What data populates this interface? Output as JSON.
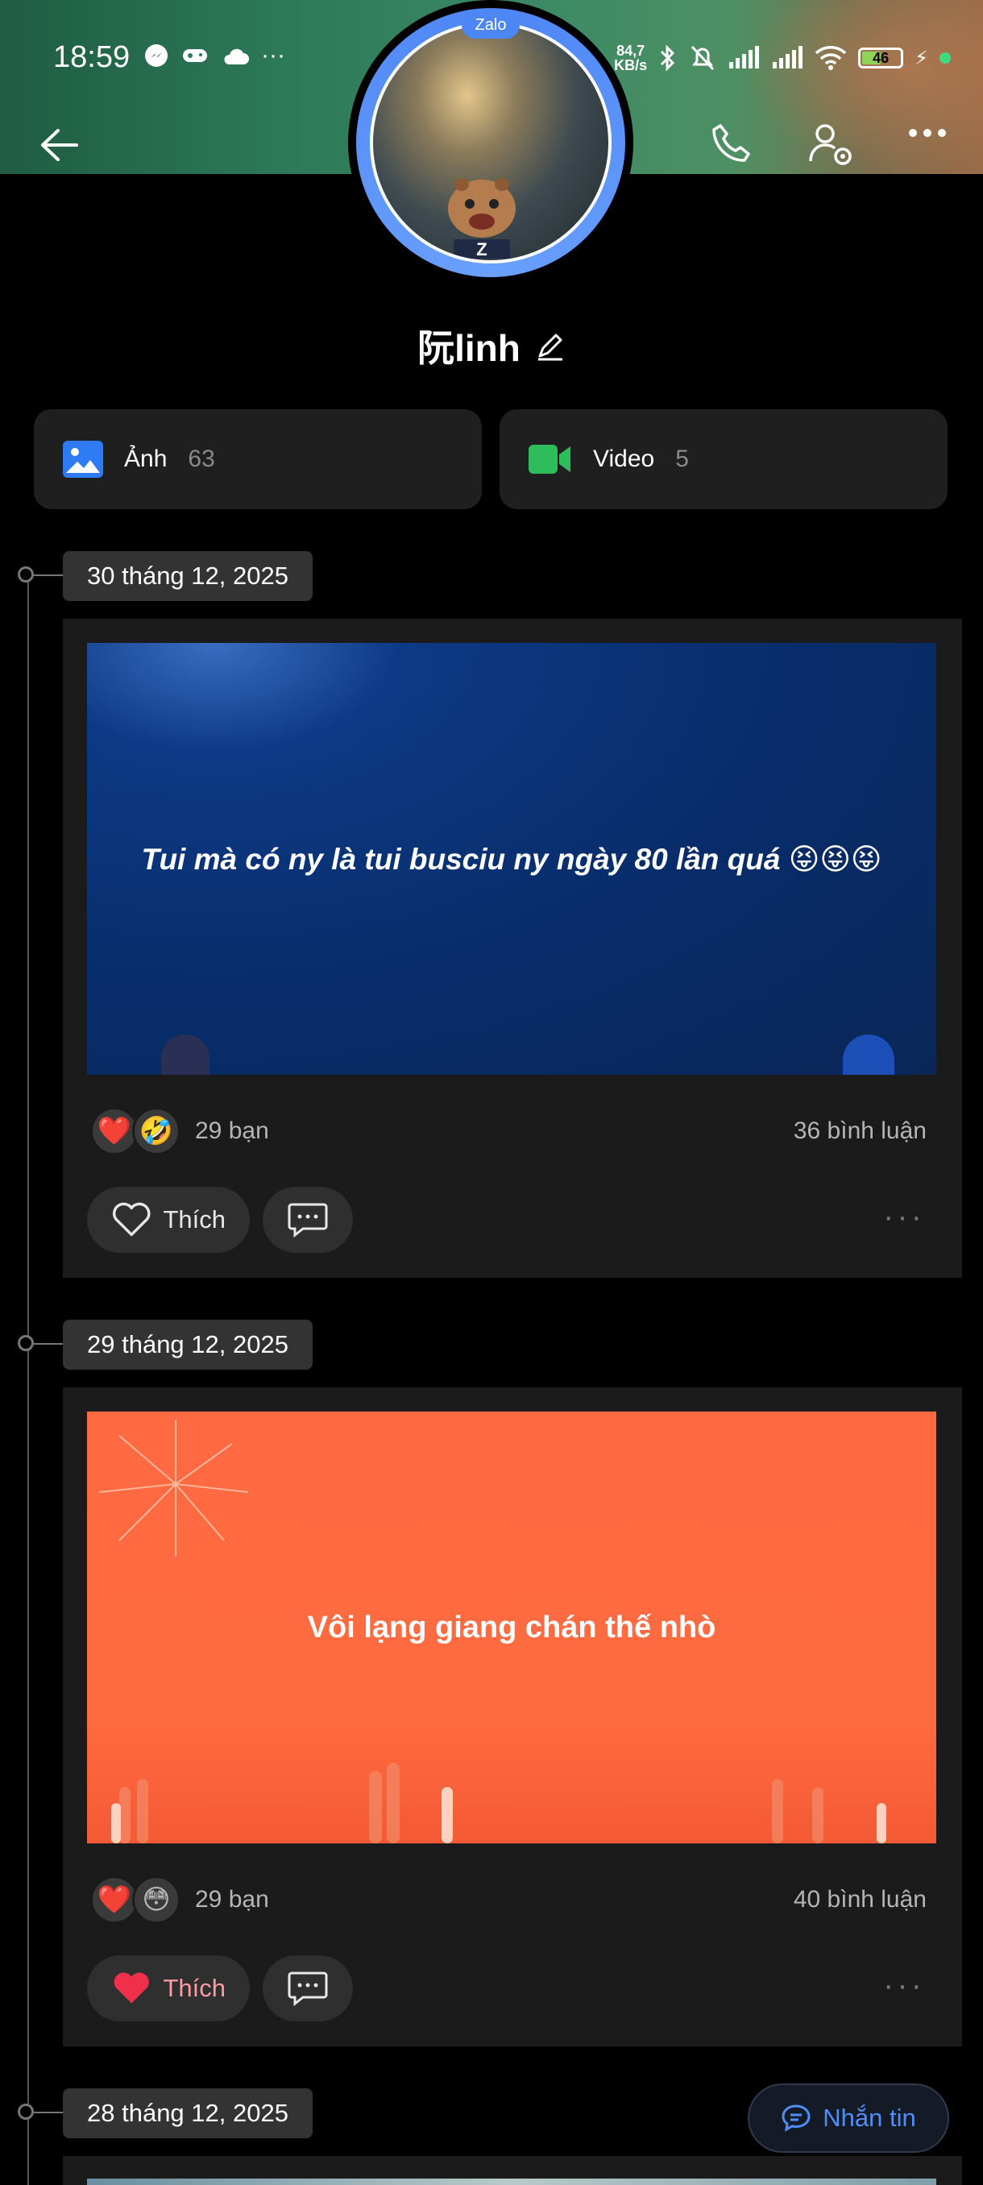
{
  "status_bar": {
    "time": "18:59",
    "net_speed_value": "84,7",
    "net_speed_unit": "KB/s",
    "battery": "46",
    "overflow": "···"
  },
  "profile": {
    "app_badge": "Zalo",
    "name": "阮linh"
  },
  "media": {
    "photos_label": "Ảnh",
    "photos_count": "63",
    "videos_label": "Video",
    "videos_count": "5"
  },
  "posts": [
    {
      "date": "30 tháng 12, 2025",
      "text": "Tui mà có ny là tui busciu ny ngày 80 lần quá 😝😝😝",
      "reactions": [
        "❤️",
        "🤣"
      ],
      "reaction_count": "29 bạn",
      "comments": "36 bình luận",
      "like_label": "Thích",
      "liked": false,
      "banner_color": "#0a2a66"
    },
    {
      "date": "29 tháng 12, 2025",
      "text": "Vôi lạng giang chán thế nhò",
      "reactions": [
        "❤️",
        "😳"
      ],
      "reaction_count": "29 bạn",
      "comments": "40 bình luận",
      "like_label": "Thích",
      "liked": true,
      "banner_color": "#ff6b40"
    },
    {
      "date": "28 tháng 12, 2025"
    }
  ],
  "message_button": {
    "label": "Nhắn tin"
  },
  "colors": {
    "accent_blue": "#4f8df7",
    "video_green": "#2fbd5c",
    "photo_blue": "#2f7bf5",
    "like_red": "#f0304a"
  }
}
